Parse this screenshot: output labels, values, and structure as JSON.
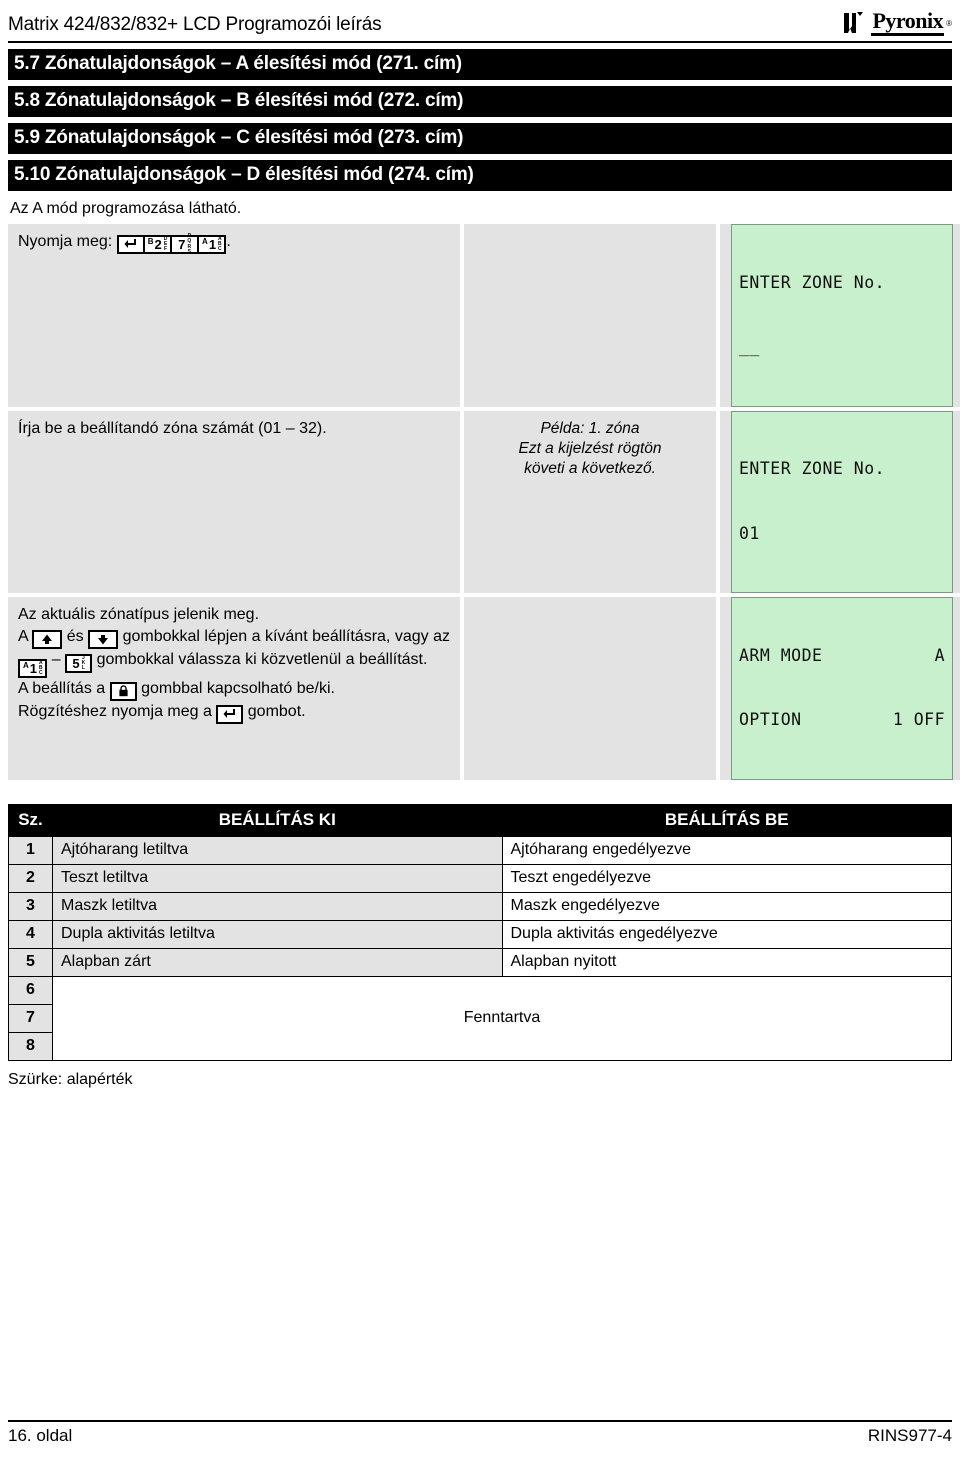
{
  "header": {
    "title": "Matrix 424/832/832+ LCD Programozói leírás",
    "logo_text": "Pyronix",
    "logo_tm": "®"
  },
  "sections": [
    "5.7 Zónatulajdonságok – A élesítési mód (271. cím)",
    "5.8 Zónatulajdonságok – B élesítési mód (272. cím)",
    "5.9 Zónatulajdonságok – C élesítési mód (273. cím)",
    "5.10 Zónatulajdonságok – D élesítési mód (274. cím)"
  ],
  "intro": "Az A mód programozása látható.",
  "steps": {
    "press_label": "Nyomja meg:",
    "press_keys": [
      {
        "name": "enter-key",
        "glyph": "enter",
        "sup": "",
        "main": "",
        "sub": ""
      },
      {
        "name": "key-2",
        "glyph": "digit",
        "sup": "B",
        "main": "2",
        "sub": "DEF"
      },
      {
        "name": "key-7",
        "glyph": "digit",
        "sup": "",
        "main": "7",
        "sub": "PQRS"
      },
      {
        "name": "key-1",
        "glyph": "digit",
        "sup": "A",
        "main": "1",
        "sub": "ABC"
      }
    ],
    "press_period": ".",
    "zone_prompt": "Írja be a beállítandó zóna számát (01 – 32).",
    "current_type": "Az aktuális zónatípus jelenik meg.",
    "nav_a": "A",
    "nav_es": "és",
    "nav_b": "gombokkal lépjen a kívánt beállításra, vagy az",
    "nav_dash": "–",
    "nav_c": "gombokkal válassza ki közvetlenül a beállítást.",
    "toggle_a": "A beállítás a",
    "toggle_b": "gombbal kapcsolható be/ki.",
    "save_a": "Rögzítéshez nyomja meg a",
    "save_b": "gombot."
  },
  "example_note": {
    "line1": "Példa: 1. zóna",
    "line2": "Ezt a kijelzést rögtön",
    "line3": "követi a következő."
  },
  "lcds": [
    {
      "name": "lcd-enter-zone-empty",
      "line1": "ENTER ZONE No.",
      "line2": "__"
    },
    {
      "name": "lcd-enter-zone-01",
      "line1": "ENTER ZONE No.",
      "line2": "01"
    },
    {
      "name": "lcd-arm-mode",
      "line1_left": "ARM MODE",
      "line1_right": "A",
      "line2_left": "OPTION",
      "line2_right": "1 OFF"
    }
  ],
  "table": {
    "headers": {
      "num": "Sz.",
      "off": "BEÁLLÍTÁS KI",
      "on": "BEÁLLÍTÁS BE"
    },
    "rows": [
      {
        "num": "1",
        "off": "Ajtóharang letiltva",
        "on": "Ajtóharang engedélyezve",
        "off_default": true,
        "on_default": false
      },
      {
        "num": "2",
        "off": "Teszt letiltva",
        "on": "Teszt engedélyezve",
        "off_default": true,
        "on_default": false
      },
      {
        "num": "3",
        "off": "Maszk letiltva",
        "on": "Maszk engedélyezve",
        "off_default": true,
        "on_default": false
      },
      {
        "num": "4",
        "off": "Dupla aktivitás letiltva",
        "on": "Dupla aktivitás engedélyezve",
        "off_default": true,
        "on_default": false
      },
      {
        "num": "5",
        "off": "Alapban zárt",
        "on": "Alapban nyitott",
        "off_default": true,
        "on_default": false
      }
    ],
    "reserved_rows": [
      "6",
      "7",
      "8"
    ],
    "reserved_label": "Fenntartva",
    "legend": "Szürke: alapérték"
  },
  "footer": {
    "left": "16. oldal",
    "right": "RINS977-4"
  },
  "colors": {
    "lcd_bg": "#c9f0cd",
    "panel_grey": "#e3e3e3",
    "bar_black": "#000000"
  }
}
